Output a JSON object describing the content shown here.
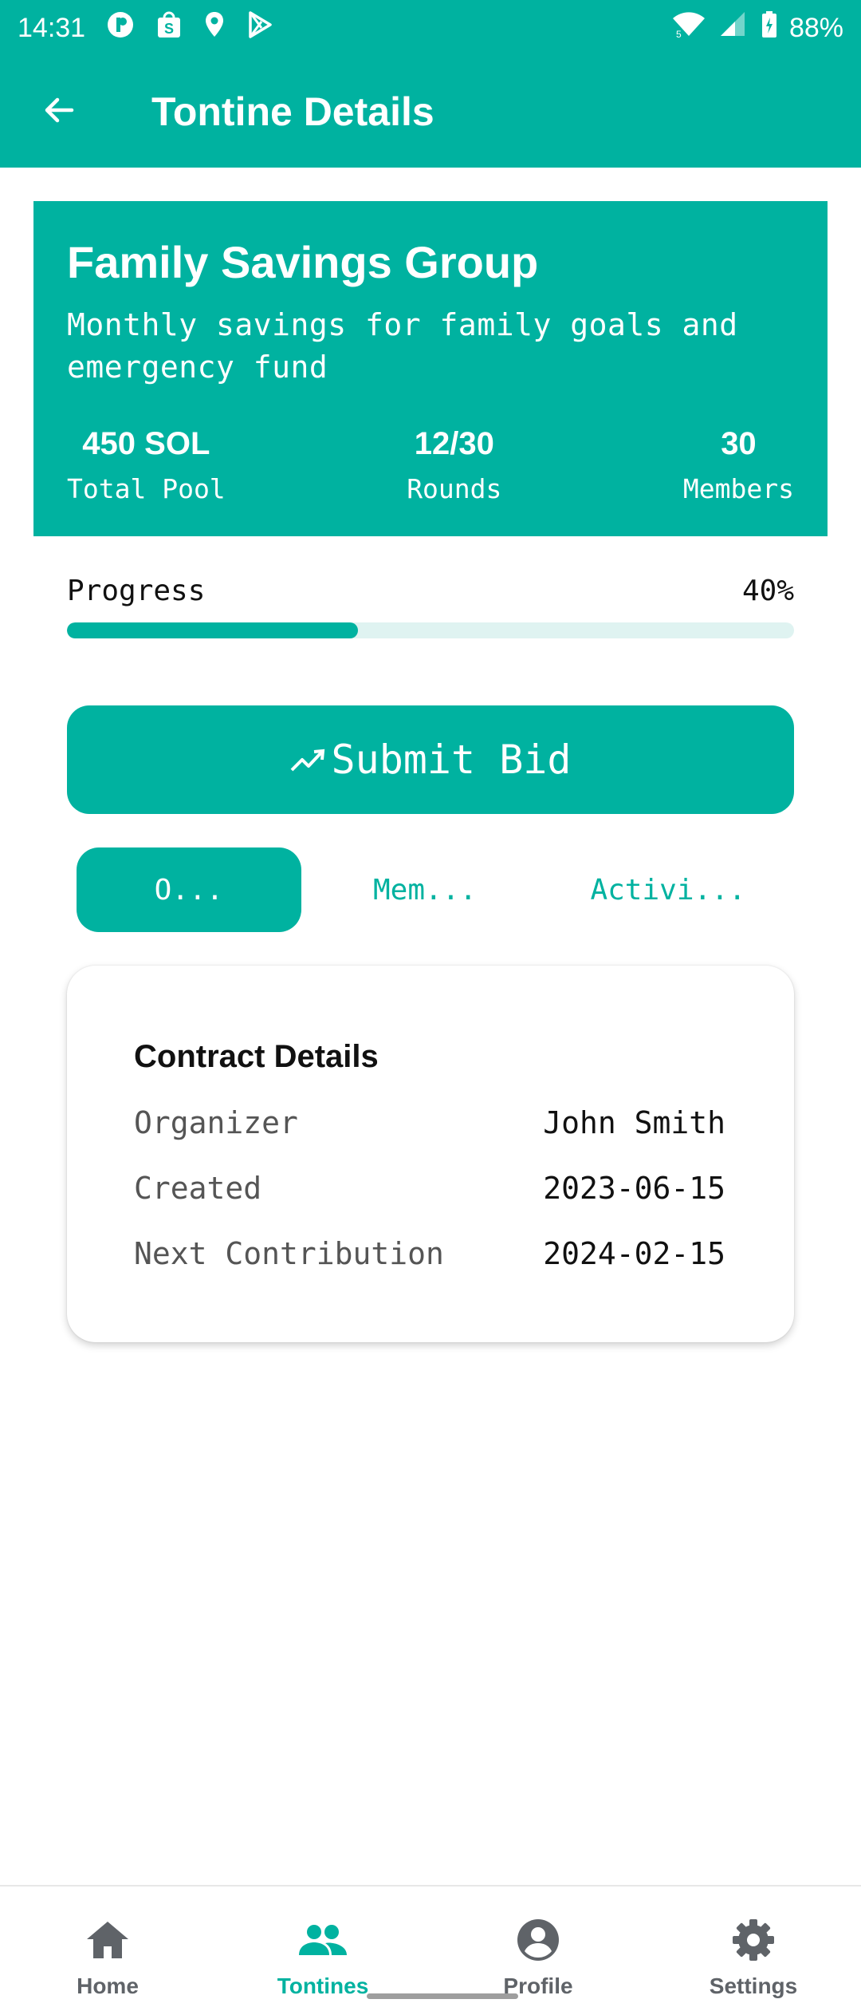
{
  "status_bar": {
    "time": "14:31",
    "battery": "88%"
  },
  "app_bar": {
    "title": "Tontine Details"
  },
  "group": {
    "name": "Family Savings Group",
    "description": "Monthly savings for family goals and emergency fund",
    "stats": [
      {
        "value": "450 SOL",
        "label": "Total Pool"
      },
      {
        "value": "12/30",
        "label": "Rounds"
      },
      {
        "value": "30",
        "label": "Members"
      }
    ]
  },
  "progress": {
    "label": "Progress",
    "percent_text": "40%",
    "value": 0.4
  },
  "bid_button": {
    "label": "Submit Bid",
    "icon": "trending-up-icon"
  },
  "tabs": [
    {
      "label": "O...",
      "active": true
    },
    {
      "label": "Mem...",
      "active": false
    },
    {
      "label": "Activi...",
      "active": false
    }
  ],
  "contract": {
    "title": "Contract Details",
    "rows": [
      {
        "label": "Organizer",
        "value": "John Smith"
      },
      {
        "label": "Created",
        "value": "2023-06-15"
      },
      {
        "label": "Next Contribution",
        "value": "2024-02-15"
      }
    ]
  },
  "bottom_nav": [
    {
      "label": "Home",
      "icon": "home-icon",
      "active": false
    },
    {
      "label": "Tontines",
      "icon": "group-icon",
      "active": true
    },
    {
      "label": "Profile",
      "icon": "account-icon",
      "active": false
    },
    {
      "label": "Settings",
      "icon": "gear-icon",
      "active": false
    }
  ],
  "colors": {
    "primary": "#00b2a0",
    "track": "#dff3f1",
    "nav_inactive": "#5f6368"
  }
}
